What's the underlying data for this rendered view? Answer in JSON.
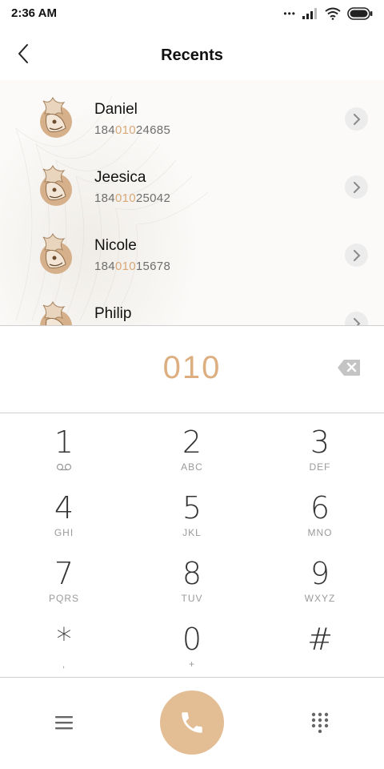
{
  "status": {
    "time": "2:36 AM",
    "signal_icon": "signal-icon",
    "wifi_icon": "wifi-icon",
    "battery_icon": "battery-icon"
  },
  "header": {
    "title": "Recents",
    "back_icon": "back-chevron-icon"
  },
  "contacts": [
    {
      "name": "Daniel",
      "number_prefix": "184",
      "number_match": "010",
      "number_suffix": "24685"
    },
    {
      "name": "Jeesica",
      "number_prefix": "184",
      "number_match": "010",
      "number_suffix": "25042"
    },
    {
      "name": "Nicole",
      "number_prefix": "184",
      "number_match": "010",
      "number_suffix": "15678"
    },
    {
      "name": "Philip",
      "number_prefix": "",
      "number_match": "",
      "number_suffix": ""
    }
  ],
  "display": {
    "number": "010",
    "backspace_icon": "backspace-icon"
  },
  "keypad": {
    "keys": [
      {
        "digit": "1",
        "letters": ""
      },
      {
        "digit": "2",
        "letters": "ABC"
      },
      {
        "digit": "3",
        "letters": "DEF"
      },
      {
        "digit": "4",
        "letters": "GHI"
      },
      {
        "digit": "5",
        "letters": "JKL"
      },
      {
        "digit": "6",
        "letters": "MNO"
      },
      {
        "digit": "7",
        "letters": "PQRS"
      },
      {
        "digit": "8",
        "letters": "TUV"
      },
      {
        "digit": "9",
        "letters": "WXYZ"
      },
      {
        "digit": "*",
        "letters": ","
      },
      {
        "digit": "0",
        "letters": "+"
      },
      {
        "digit": "#",
        "letters": ""
      }
    ]
  },
  "colors": {
    "accent": "#dcae80",
    "call_button": "#e3bd94",
    "highlight": "#d9a878"
  }
}
